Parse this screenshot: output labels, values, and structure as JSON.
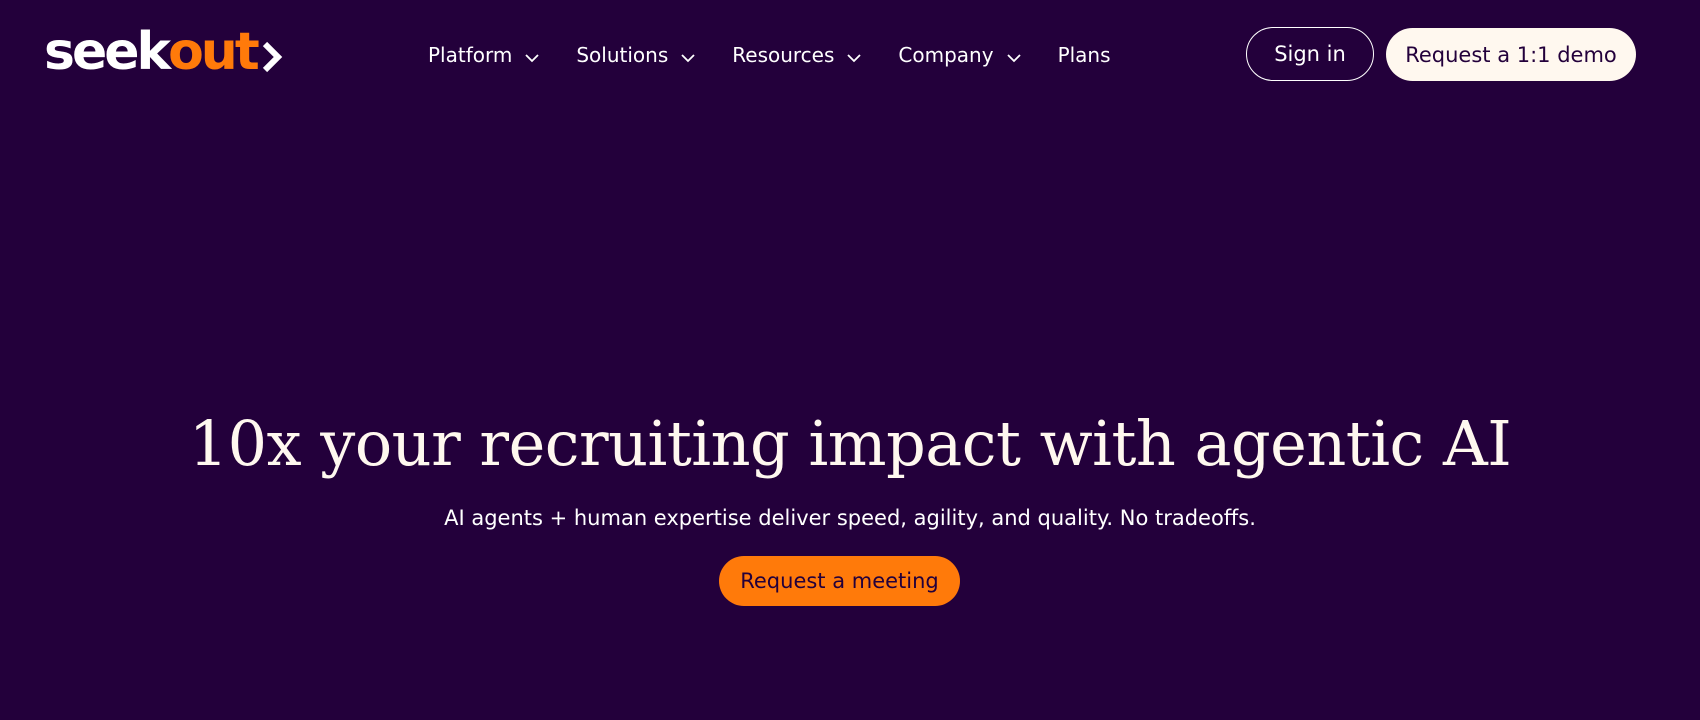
{
  "header": {
    "logo": {
      "part1": "seek",
      "part2": "out"
    },
    "nav": [
      {
        "label": "Platform",
        "has_dropdown": true
      },
      {
        "label": "Solutions",
        "has_dropdown": true
      },
      {
        "label": "Resources",
        "has_dropdown": true
      },
      {
        "label": "Company",
        "has_dropdown": true
      },
      {
        "label": "Plans",
        "has_dropdown": false
      }
    ],
    "sign_in_label": "Sign in",
    "demo_label": "Request a 1:1 demo"
  },
  "hero": {
    "title": "10x your recruiting impact with agentic AI",
    "subtitle": "AI agents + human expertise deliver speed, agility, and quality. No tradeoffs.",
    "cta_label": "Request a meeting"
  },
  "colors": {
    "background": "#23003b",
    "accent": "#ff7a0a",
    "cream": "#fff8ef",
    "text": "#ffffff"
  },
  "icons": {
    "logo_chevron": "chevron-right-icon",
    "nav_caret": "chevron-down-icon"
  }
}
